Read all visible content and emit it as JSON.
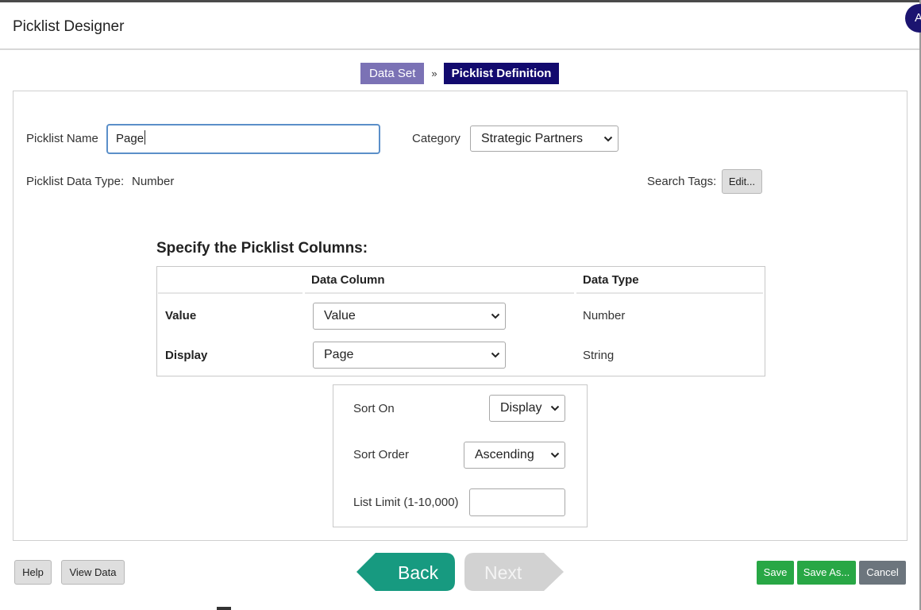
{
  "window": {
    "title": "Picklist Designer",
    "avatar_initial": "A"
  },
  "steps": {
    "step1": "Data Set",
    "separator": "»",
    "step2": "Picklist Definition"
  },
  "form": {
    "name_label": "Picklist Name",
    "name_value": "Page",
    "category_label": "Category",
    "category_value": "Strategic Partners",
    "data_type_label": "Picklist Data Type:",
    "data_type_value": "Number",
    "search_tags_label": "Search Tags:",
    "edit_button": "Edit..."
  },
  "columns": {
    "title": "Specify the Picklist Columns:",
    "header_data_column": "Data Column",
    "header_data_type": "Data Type",
    "rows": [
      {
        "label": "Value",
        "column": "Value",
        "type": "Number"
      },
      {
        "label": "Display",
        "column": "Page",
        "type": "String"
      }
    ]
  },
  "sort": {
    "sort_on_label": "Sort On",
    "sort_on_value": "Display",
    "sort_order_label": "Sort Order",
    "sort_order_value": "Ascending",
    "list_limit_label": "List Limit (1-10,000)",
    "list_limit_value": ""
  },
  "footer": {
    "help": "Help",
    "view_data": "View Data",
    "back": "Back",
    "next": "Next",
    "save": "Save",
    "save_as": "Save As...",
    "cancel": "Cancel"
  },
  "colors": {
    "step_inactive": "#7b72b5",
    "step_active": "#120a6e",
    "back": "#179a80",
    "next_disabled": "#d2d2d2",
    "save": "#28a745",
    "cancel": "#6c757d"
  },
  "icons": {
    "dropdown": "chevron-down-icon"
  }
}
